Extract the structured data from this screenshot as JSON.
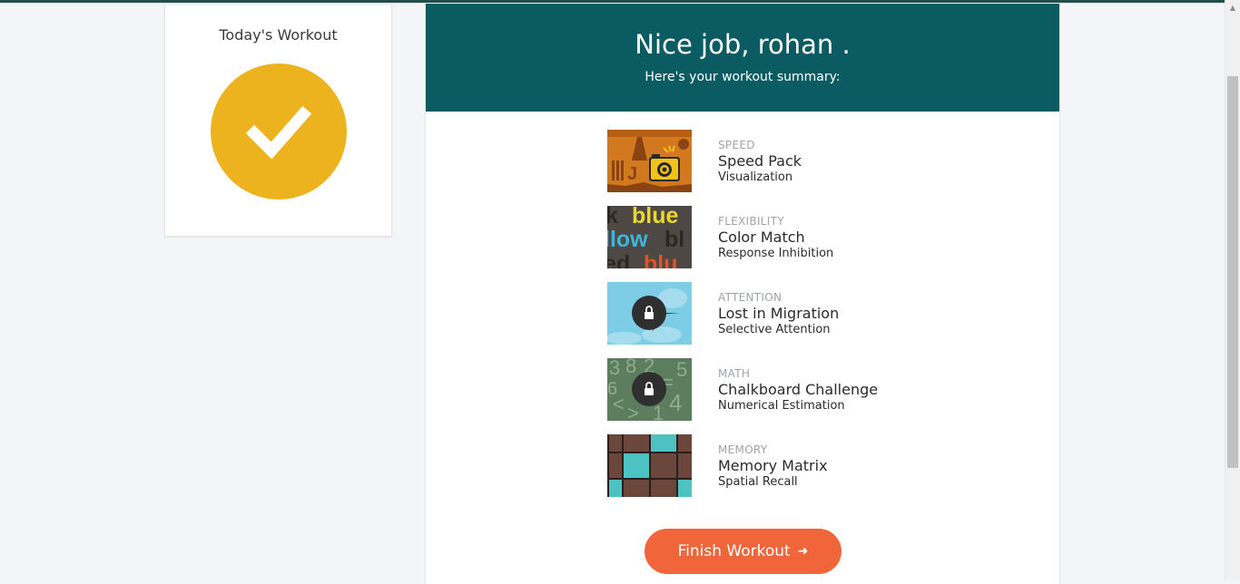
{
  "left_card": {
    "title": "Today's Workout",
    "status_color": "#ecb31f"
  },
  "summary": {
    "title": "Nice job, rohan .",
    "subtitle": "Here's your workout summary:",
    "header_color": "#0a5b62"
  },
  "games": [
    {
      "category": "SPEED",
      "name": "Speed Pack",
      "skill": "Visualization",
      "locked": false,
      "icon": "speed-pack-thumbnail"
    },
    {
      "category": "FLEXIBILITY",
      "name": "Color Match",
      "skill": "Response Inhibition",
      "locked": false,
      "icon": "color-match-thumbnail"
    },
    {
      "category": "ATTENTION",
      "name": "Lost in Migration",
      "skill": "Selective Attention",
      "locked": true,
      "icon": "lost-in-migration-thumbnail"
    },
    {
      "category": "MATH",
      "name": "Chalkboard Challenge",
      "skill": "Numerical Estimation",
      "locked": true,
      "icon": "chalkboard-challenge-thumbnail"
    },
    {
      "category": "MEMORY",
      "name": "Memory Matrix",
      "skill": "Spatial Recall",
      "locked": false,
      "icon": "memory-matrix-thumbnail"
    }
  ],
  "finish_button": {
    "label": "Finish Workout",
    "arrow": "➜",
    "color": "#f0653a"
  },
  "thumb_text": {
    "color_match_words": [
      "k",
      "blue",
      "llow",
      "bl",
      "ed",
      "blu"
    ],
    "speed_pack_letters": [
      "J"
    ],
    "chalkboard_symbols": [
      "3",
      "8",
      "2",
      "5",
      "6",
      "=",
      "<",
      "4",
      ">",
      "1"
    ]
  }
}
